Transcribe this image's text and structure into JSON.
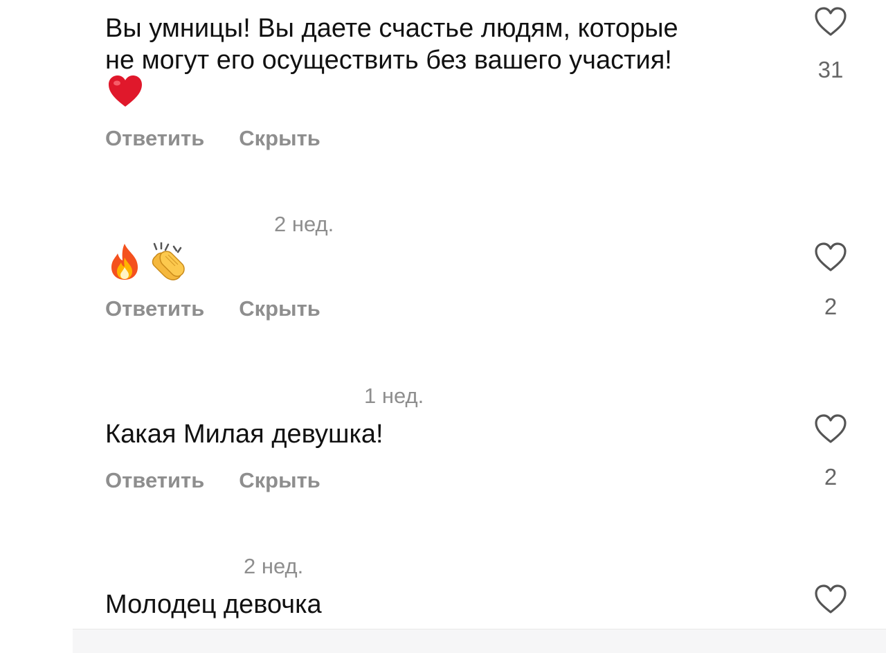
{
  "comments": [
    {
      "time": "",
      "text": "Вы умницы! Вы даете счастье людям, которые\nне могут его осуществить без вашего участия!",
      "emoji": [
        "red-heart"
      ],
      "reply_label": "Ответить",
      "hide_label": "Скрыть",
      "likes": "31"
    },
    {
      "time": "2 нед.",
      "text": "",
      "emoji": [
        "fire",
        "clapping-hands"
      ],
      "reply_label": "Ответить",
      "hide_label": "Скрыть",
      "likes": "2"
    },
    {
      "time": "1 нед.",
      "text": "Какая Милая девушка!",
      "emoji": [],
      "reply_label": "Ответить",
      "hide_label": "Скрыть",
      "likes": "2"
    },
    {
      "time": "2 нед.",
      "text": "Молодец девочка",
      "emoji": [],
      "reply_label": "",
      "hide_label": "",
      "likes": ""
    }
  ],
  "colors": {
    "text": "#111111",
    "secondary": "#8e8e8e",
    "heart_red": "#e0182b",
    "icon_stroke": "#555555"
  }
}
